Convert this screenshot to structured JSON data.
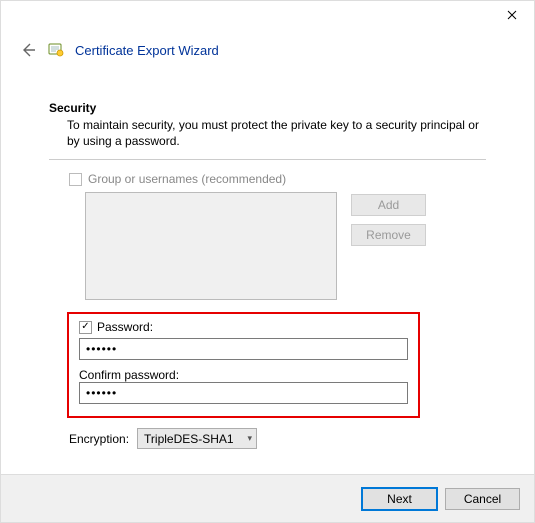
{
  "window": {
    "title": "Certificate Export Wizard"
  },
  "section": {
    "heading": "Security",
    "description": "To maintain security, you must protect the private key to a security principal or by using a password."
  },
  "group": {
    "checkbox_label": "Group or usernames (recommended)",
    "checked": false,
    "enabled": false,
    "add_label": "Add",
    "remove_label": "Remove"
  },
  "password": {
    "checkbox_label": "Password:",
    "checked": true,
    "value": "••••••",
    "confirm_label": "Confirm password:",
    "confirm_value": "••••••"
  },
  "encryption": {
    "label": "Encryption:",
    "selected": "TripleDES-SHA1"
  },
  "footer": {
    "next": "Next",
    "cancel": "Cancel"
  }
}
